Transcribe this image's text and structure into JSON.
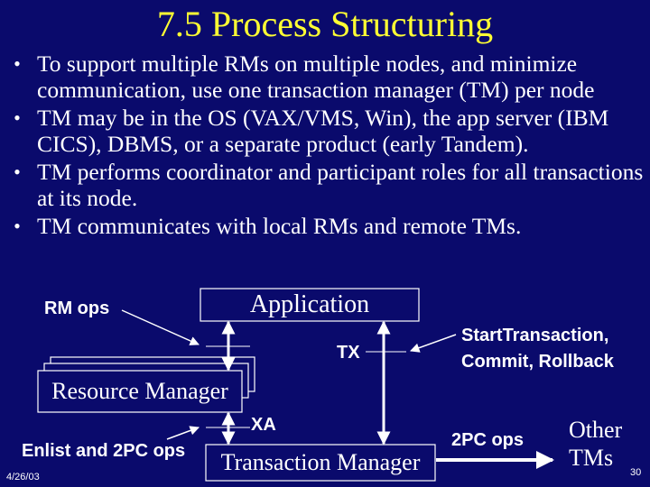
{
  "slide": {
    "title": "7.5 Process Structuring",
    "colors": {
      "background": "#0a0a6c",
      "title": "#ffff33",
      "text": "#ffffff"
    },
    "bullets": [
      {
        "marker": "•",
        "text": "To support multiple RMs on multiple nodes, and minimize communication, use one transaction manager (TM) per node"
      },
      {
        "marker": "•",
        "text": "TM may be in the OS (VAX/VMS, Win), the app server (IBM CICS), DBMS, or a separate product (early Tandem)."
      },
      {
        "marker": "•",
        "text": "TM performs coordinator and participant roles for all transactions at its node."
      },
      {
        "marker": "•",
        "text": "TM communicates with local RMs and remote TMs."
      }
    ],
    "diagram": {
      "boxes": {
        "application": "Application",
        "resource_manager": "Resource Manager",
        "transaction_manager": "Transaction Manager"
      },
      "labels": {
        "rm_ops": "RM ops",
        "tx": "TX",
        "xa": "XA",
        "start_commit_rollback_line1": "StartTransaction,",
        "start_commit_rollback_line2": "Commit, Rollback",
        "enlist_2pc_ops": "Enlist and 2PC ops",
        "two_pc_ops": "2PC ops",
        "other_tms_line1": "Other",
        "other_tms_line2": "TMs"
      }
    },
    "footer": {
      "date": "4/26/03",
      "page_number": "30"
    }
  }
}
